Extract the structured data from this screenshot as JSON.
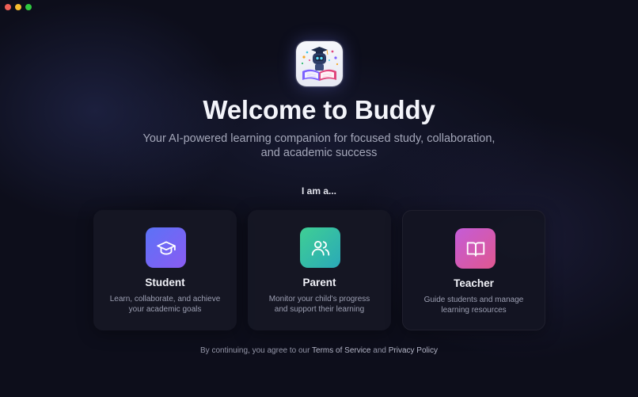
{
  "window": {
    "controls": [
      "close",
      "minimize",
      "maximize"
    ]
  },
  "logo": {
    "icon": "robot-reading-book-icon"
  },
  "header": {
    "title": "Welcome to Buddy",
    "subtitle": "Your AI-powered learning companion for focused study, collaboration, and academic success"
  },
  "role_prompt": "I am a...",
  "roles": [
    {
      "title": "Student",
      "description": "Learn, collaborate, and achieve your academic goals",
      "icon": "graduation-cap-icon",
      "color": "#6a67f5"
    },
    {
      "title": "Parent",
      "description": "Monitor your child's progress and support their learning",
      "icon": "users-icon",
      "color": "#37bfa3"
    },
    {
      "title": "Teacher",
      "description": "Guide students and manage learning resources",
      "icon": "book-open-icon",
      "color": "#d25ab5"
    }
  ],
  "footer": {
    "prefix": "By continuing, you agree to our ",
    "terms": "Terms of Service",
    "and": " and ",
    "privacy": "Privacy Policy"
  }
}
